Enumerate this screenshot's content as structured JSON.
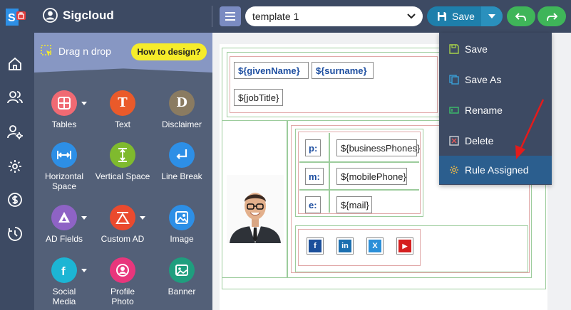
{
  "app": {
    "brand": "Sigcloud"
  },
  "toolbar": {
    "template_value": "template 1",
    "save_label": "Save"
  },
  "palette": {
    "header": "Drag n drop",
    "howto_label": "How to design?",
    "tools": [
      {
        "label": "Tables",
        "icon": "table-icon",
        "color": "#f06a73"
      },
      {
        "label": "Text",
        "icon": "text-icon",
        "color": "#ea5a2a"
      },
      {
        "label": "Disclaimer",
        "icon": "disclaimer-icon",
        "color": "#8a7b61"
      },
      {
        "label": "Horizontal Space",
        "icon": "horizontal-space-icon",
        "color": "#2d8fe6"
      },
      {
        "label": "Vertical Space",
        "icon": "vertical-space-icon",
        "color": "#7fba2e"
      },
      {
        "label": "Line Break",
        "icon": "line-break-icon",
        "color": "#2d8fe6"
      },
      {
        "label": "AD Fields",
        "icon": "ad-fields-icon",
        "color": "#8e63c5"
      },
      {
        "label": "Custom AD",
        "icon": "custom-ad-icon",
        "color": "#ea4a2e"
      },
      {
        "label": "Image",
        "icon": "image-icon",
        "color": "#2d8fe6"
      },
      {
        "label": "Social Media",
        "icon": "social-media-icon",
        "color": "#1cb5d4"
      },
      {
        "label": "Profile Photo",
        "icon": "profile-photo-icon",
        "color": "#e8367c"
      },
      {
        "label": "Banner",
        "icon": "banner-icon",
        "color": "#1f9e7e"
      }
    ]
  },
  "signature": {
    "given_name": "${givenName}",
    "surname": "${surname}",
    "job_title": "${jobTitle}",
    "phone_label": "p:",
    "phone_value": "${businessPhones}",
    "mobile_label": "m:",
    "mobile_value": "${mobilePhone}",
    "email_label": "e:",
    "email_value": "${mail}",
    "social": [
      {
        "icon": "facebook-icon",
        "glyph": "f",
        "color": "#1b4f9b"
      },
      {
        "icon": "linkedin-icon",
        "glyph": "in",
        "color": "#1b6fb0"
      },
      {
        "icon": "x-twitter-icon",
        "glyph": "𝕏",
        "color": "#2b8fd8"
      },
      {
        "icon": "youtube-icon",
        "glyph": "▶",
        "color": "#d51f1f"
      }
    ]
  },
  "save_menu": {
    "items": [
      {
        "label": "Save",
        "icon": "save-icon"
      },
      {
        "label": "Save As",
        "icon": "save-as-icon"
      },
      {
        "label": "Rename",
        "icon": "rename-icon"
      },
      {
        "label": "Delete",
        "icon": "delete-icon"
      },
      {
        "label": "Rule Assigned",
        "icon": "rule-assigned-icon",
        "active": true
      }
    ]
  },
  "colors": {
    "sidebar": "#3d4a63",
    "palette": "#536078",
    "save_button": "#1e7fab",
    "undo_redo": "#3fb559",
    "howto": "#f6ec2a",
    "menu_active": "#2b5e8e",
    "annotation_arrow": "#e31b1b"
  }
}
